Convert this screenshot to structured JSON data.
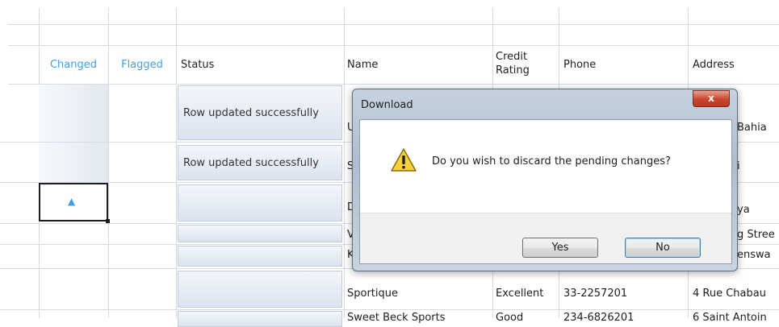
{
  "columns": {
    "changed": "Changed",
    "flagged": "Flagged",
    "status": "Status",
    "name": "Name",
    "credit_rating": "Credit\nRating",
    "phone": "Phone",
    "address": "Address"
  },
  "rows": {
    "r1": {
      "status": "Row updated successfully",
      "name_frag": "U",
      "address_frag": "Bahia"
    },
    "r2": {
      "status": "Row updated successfully",
      "name_frag": "S",
      "address_frag": "i"
    },
    "r3": {
      "name_frag": "D",
      "address_frag": "ya",
      "changed_marker": "▲"
    },
    "r4": {
      "name_frag": "V",
      "address_frag": "g Stree"
    },
    "r5": {
      "name_frag": "K",
      "address_frag": "enswa"
    },
    "r6": {
      "name": "Sportique",
      "credit_rating": "Excellent",
      "phone": "33-2257201",
      "address": "4 Rue Chabau"
    },
    "r7": {
      "name": "Sweet Beck Sports",
      "credit_rating": "Good",
      "phone": "234-6826201",
      "address": "6 Saint Antoin"
    }
  },
  "dialog": {
    "title": "Download",
    "close_label": "x",
    "message": "Do you wish to discard the pending changes?",
    "icon": "warning-icon",
    "yes_label": "Yes",
    "no_label": "No"
  }
}
